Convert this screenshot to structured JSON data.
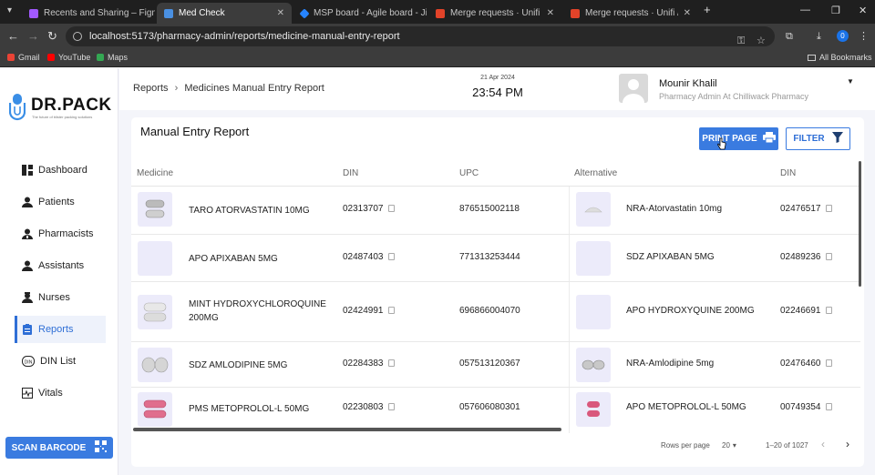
{
  "browser": {
    "tabs": [
      {
        "title": "Recents and Sharing – Figma",
        "color": "#a259ff"
      },
      {
        "title": "Med Check",
        "color": "#4a90e2"
      },
      {
        "title": "MSP board - Agile board - Jira",
        "color": "#2684ff"
      },
      {
        "title": "Merge requests · Unifi / MedC",
        "color": "#e24329"
      },
      {
        "title": "Merge requests · Unifi / MedC",
        "color": "#e24329"
      }
    ],
    "url": "localhost:5173/pharmacy-admin/reports/medicine-manual-entry-report",
    "profile_initial": "0",
    "bookmarks": [
      {
        "label": "Gmail",
        "color": "#ea4335"
      },
      {
        "label": "YouTube",
        "color": "#ff0000"
      },
      {
        "label": "Maps",
        "color": "#34a853"
      }
    ],
    "all_bookmarks": "All Bookmarks"
  },
  "app": {
    "brand": "DR.PACK",
    "tagline": "The future of blister packing solutions",
    "nav": [
      {
        "label": "Dashboard",
        "icon": "dashboard-icon"
      },
      {
        "label": "Patients",
        "icon": "person-icon"
      },
      {
        "label": "Pharmacists",
        "icon": "pharmacist-icon"
      },
      {
        "label": "Assistants",
        "icon": "assistant-icon"
      },
      {
        "label": "Nurses",
        "icon": "nurse-icon"
      },
      {
        "label": "Reports",
        "icon": "report-icon"
      },
      {
        "label": "DIN List",
        "icon": "din-icon"
      },
      {
        "label": "Vitals",
        "icon": "vitals-icon"
      }
    ],
    "scan_barcode": "SCAN BARCODE",
    "breadcrumb": {
      "root": "Reports",
      "sep": "›",
      "current": "Medicines Manual Entry Report"
    },
    "date": "21 Apr 2024",
    "time": "23:54 PM",
    "user": {
      "name": "Mounir Khalil",
      "role": "Pharmacy Admin At Chilliwack Pharmacy"
    }
  },
  "report": {
    "title": "Manual Entry Report",
    "print_label": "PRINT PAGE",
    "filter_label": "FILTER",
    "columns": [
      "Medicine",
      "DIN",
      "UPC",
      "Alternative",
      "DIN"
    ],
    "rows": [
      {
        "medicine": "TARO ATORVASTATIN 10MG",
        "din": "02313707",
        "upc": "876515002118",
        "alternative": "NRA-Atorvastatin 10mg",
        "alt_din": "02476517"
      },
      {
        "medicine": "APO APIXABAN 5MG",
        "din": "02487403",
        "upc": "771313253444",
        "alternative": "SDZ APIXABAN 5MG",
        "alt_din": "02489236"
      },
      {
        "medicine": "MINT HYDROXYCHLOROQUINE 200MG",
        "din": "02424991",
        "upc": "696866004070",
        "alternative": "APO HYDROXYQUINE 200MG",
        "alt_din": "02246691"
      },
      {
        "medicine": "SDZ AMLODIPINE 5MG",
        "din": "02284383",
        "upc": "057513120367",
        "alternative": "NRA-Amlodipine 5mg",
        "alt_din": "02476460"
      },
      {
        "medicine": "PMS METOPROLOL-L 50MG",
        "din": "02230803",
        "upc": "057606080301",
        "alternative": "APO METOPROLOL-L 50MG",
        "alt_din": "00749354"
      }
    ],
    "pagination": {
      "rows_per_page_label": "Rows per page",
      "rows_per_page": "20",
      "range": "1–20 of 1027"
    }
  }
}
